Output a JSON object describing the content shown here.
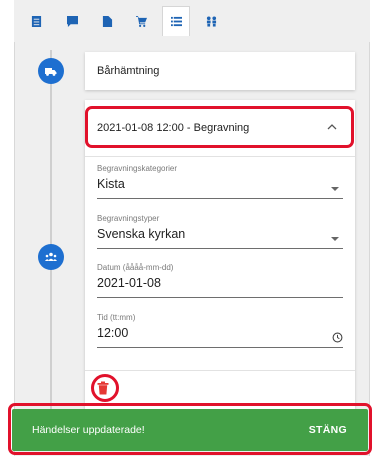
{
  "tabs": [
    {
      "icon": "list-doc-icon"
    },
    {
      "icon": "comment-icon"
    },
    {
      "icon": "file-icon"
    },
    {
      "icon": "cart-icon"
    },
    {
      "icon": "list-icon",
      "active": true
    },
    {
      "icon": "people-icon"
    }
  ],
  "events": {
    "transport": {
      "icon": "truck-icon",
      "title": "Bårhämtning"
    },
    "funeral": {
      "icon": "group-icon",
      "title": "2021-01-08 12:00 - Begravning",
      "category": {
        "label": "Begravningskategorier",
        "value": "Kista"
      },
      "type": {
        "label": "Begravningstyper",
        "value": "Svenska kyrkan"
      },
      "date": {
        "label": "Datum (åååå-mm-dd)",
        "value": "2021-01-08"
      },
      "time": {
        "label": "Tid (tt:mm)",
        "value": "12:00"
      }
    }
  },
  "snackbar": {
    "message": "Händelser uppdaterade!",
    "action": "STÄNG"
  },
  "colors": {
    "primary": "#1e64b4",
    "success": "#43a047",
    "highlight": "#e1112b",
    "delete": "#e53935"
  }
}
